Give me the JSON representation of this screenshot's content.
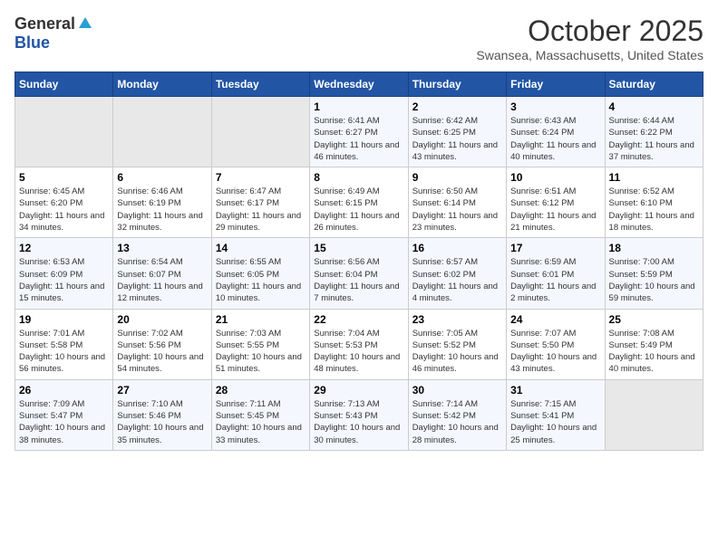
{
  "logo": {
    "general": "General",
    "blue": "Blue"
  },
  "title": "October 2025",
  "location": "Swansea, Massachusetts, United States",
  "days_of_week": [
    "Sunday",
    "Monday",
    "Tuesday",
    "Wednesday",
    "Thursday",
    "Friday",
    "Saturday"
  ],
  "weeks": [
    [
      {
        "day": "",
        "empty": true
      },
      {
        "day": "",
        "empty": true
      },
      {
        "day": "",
        "empty": true
      },
      {
        "day": "1",
        "sunrise": "6:41 AM",
        "sunset": "6:27 PM",
        "daylight": "11 hours and 46 minutes."
      },
      {
        "day": "2",
        "sunrise": "6:42 AM",
        "sunset": "6:25 PM",
        "daylight": "11 hours and 43 minutes."
      },
      {
        "day": "3",
        "sunrise": "6:43 AM",
        "sunset": "6:24 PM",
        "daylight": "11 hours and 40 minutes."
      },
      {
        "day": "4",
        "sunrise": "6:44 AM",
        "sunset": "6:22 PM",
        "daylight": "11 hours and 37 minutes."
      }
    ],
    [
      {
        "day": "5",
        "sunrise": "6:45 AM",
        "sunset": "6:20 PM",
        "daylight": "11 hours and 34 minutes."
      },
      {
        "day": "6",
        "sunrise": "6:46 AM",
        "sunset": "6:19 PM",
        "daylight": "11 hours and 32 minutes."
      },
      {
        "day": "7",
        "sunrise": "6:47 AM",
        "sunset": "6:17 PM",
        "daylight": "11 hours and 29 minutes."
      },
      {
        "day": "8",
        "sunrise": "6:49 AM",
        "sunset": "6:15 PM",
        "daylight": "11 hours and 26 minutes."
      },
      {
        "day": "9",
        "sunrise": "6:50 AM",
        "sunset": "6:14 PM",
        "daylight": "11 hours and 23 minutes."
      },
      {
        "day": "10",
        "sunrise": "6:51 AM",
        "sunset": "6:12 PM",
        "daylight": "11 hours and 21 minutes."
      },
      {
        "day": "11",
        "sunrise": "6:52 AM",
        "sunset": "6:10 PM",
        "daylight": "11 hours and 18 minutes."
      }
    ],
    [
      {
        "day": "12",
        "sunrise": "6:53 AM",
        "sunset": "6:09 PM",
        "daylight": "11 hours and 15 minutes."
      },
      {
        "day": "13",
        "sunrise": "6:54 AM",
        "sunset": "6:07 PM",
        "daylight": "11 hours and 12 minutes."
      },
      {
        "day": "14",
        "sunrise": "6:55 AM",
        "sunset": "6:05 PM",
        "daylight": "11 hours and 10 minutes."
      },
      {
        "day": "15",
        "sunrise": "6:56 AM",
        "sunset": "6:04 PM",
        "daylight": "11 hours and 7 minutes."
      },
      {
        "day": "16",
        "sunrise": "6:57 AM",
        "sunset": "6:02 PM",
        "daylight": "11 hours and 4 minutes."
      },
      {
        "day": "17",
        "sunrise": "6:59 AM",
        "sunset": "6:01 PM",
        "daylight": "11 hours and 2 minutes."
      },
      {
        "day": "18",
        "sunrise": "7:00 AM",
        "sunset": "5:59 PM",
        "daylight": "10 hours and 59 minutes."
      }
    ],
    [
      {
        "day": "19",
        "sunrise": "7:01 AM",
        "sunset": "5:58 PM",
        "daylight": "10 hours and 56 minutes."
      },
      {
        "day": "20",
        "sunrise": "7:02 AM",
        "sunset": "5:56 PM",
        "daylight": "10 hours and 54 minutes."
      },
      {
        "day": "21",
        "sunrise": "7:03 AM",
        "sunset": "5:55 PM",
        "daylight": "10 hours and 51 minutes."
      },
      {
        "day": "22",
        "sunrise": "7:04 AM",
        "sunset": "5:53 PM",
        "daylight": "10 hours and 48 minutes."
      },
      {
        "day": "23",
        "sunrise": "7:05 AM",
        "sunset": "5:52 PM",
        "daylight": "10 hours and 46 minutes."
      },
      {
        "day": "24",
        "sunrise": "7:07 AM",
        "sunset": "5:50 PM",
        "daylight": "10 hours and 43 minutes."
      },
      {
        "day": "25",
        "sunrise": "7:08 AM",
        "sunset": "5:49 PM",
        "daylight": "10 hours and 40 minutes."
      }
    ],
    [
      {
        "day": "26",
        "sunrise": "7:09 AM",
        "sunset": "5:47 PM",
        "daylight": "10 hours and 38 minutes."
      },
      {
        "day": "27",
        "sunrise": "7:10 AM",
        "sunset": "5:46 PM",
        "daylight": "10 hours and 35 minutes."
      },
      {
        "day": "28",
        "sunrise": "7:11 AM",
        "sunset": "5:45 PM",
        "daylight": "10 hours and 33 minutes."
      },
      {
        "day": "29",
        "sunrise": "7:13 AM",
        "sunset": "5:43 PM",
        "daylight": "10 hours and 30 minutes."
      },
      {
        "day": "30",
        "sunrise": "7:14 AM",
        "sunset": "5:42 PM",
        "daylight": "10 hours and 28 minutes."
      },
      {
        "day": "31",
        "sunrise": "7:15 AM",
        "sunset": "5:41 PM",
        "daylight": "10 hours and 25 minutes."
      },
      {
        "day": "",
        "empty": true
      }
    ]
  ]
}
